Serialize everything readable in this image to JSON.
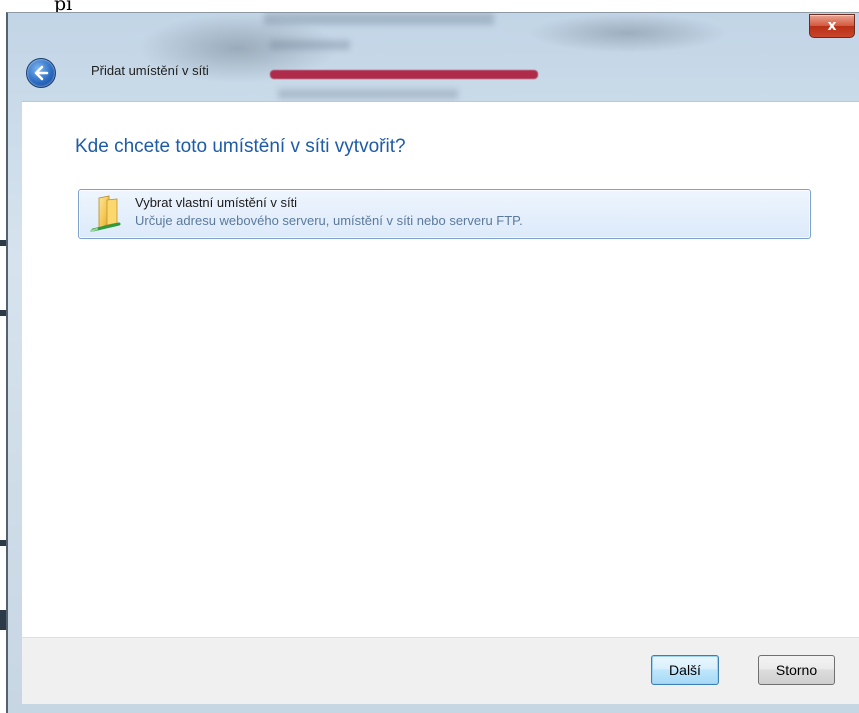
{
  "background_fragment": "pi",
  "window": {
    "title": "Přidat umístění v síti",
    "close_label": "x"
  },
  "main": {
    "heading": "Kde chcete toto umístění v síti vytvořit?",
    "option": {
      "title": "Vybrat vlastní umístění v síti",
      "description": "Určuje adresu webového serveru, umístění v síti nebo serveru FTP.",
      "icon": "folder-network-icon"
    }
  },
  "footer": {
    "next_label": "Další",
    "cancel_label": "Storno"
  },
  "colors": {
    "heading": "#1d5ca7",
    "option_border": "#7da2ce",
    "option_bg": "#dceafa",
    "close_button": "#c9452b"
  }
}
